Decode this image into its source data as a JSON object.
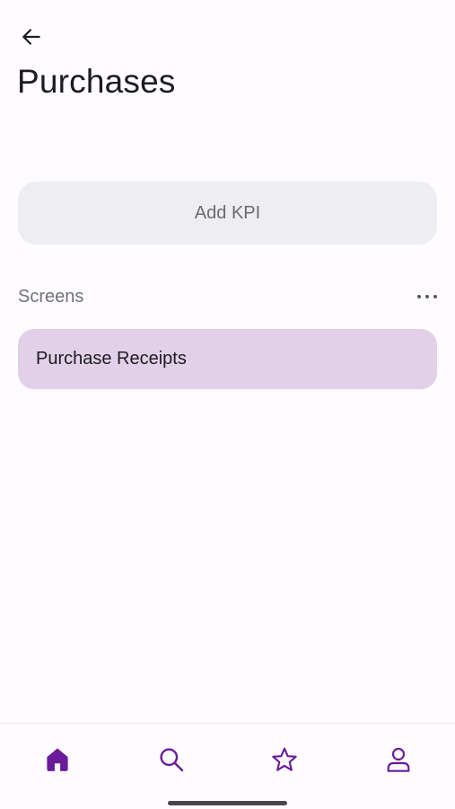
{
  "header": {
    "back_icon": "arrow-left-icon",
    "title": "Purchases"
  },
  "kpi": {
    "add_label": "Add KPI"
  },
  "screens_section": {
    "title": "Screens",
    "more_icon": "more-horizontal-icon",
    "items": [
      {
        "label": "Purchase Receipts"
      }
    ]
  },
  "bottom_nav": {
    "items": [
      {
        "icon": "home-icon",
        "active": true
      },
      {
        "icon": "search-icon",
        "active": false
      },
      {
        "icon": "star-icon",
        "active": false
      },
      {
        "icon": "person-icon",
        "active": false
      }
    ]
  },
  "colors": {
    "accent": "#6a1b9a",
    "selected_item_bg": "#e2d0e8",
    "button_bg": "#eeedef",
    "page_bg": "#fefcff"
  }
}
